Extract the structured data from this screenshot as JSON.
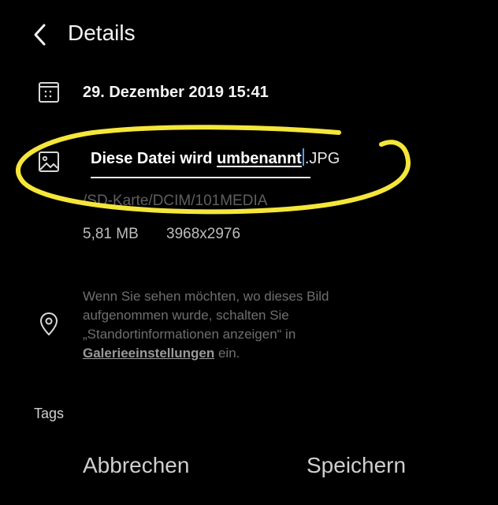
{
  "header": {
    "title": "Details",
    "back_icon": "chevron-left-icon"
  },
  "date": {
    "icon": "calendar-icon",
    "text": "29. Dezember 2019 15:41"
  },
  "file": {
    "icon": "image-icon",
    "name_prefix": "Diese Datei wird ",
    "name_underlined": "umbenannt",
    "extension": ".JPG",
    "path": "/SD-Karte/DCIM/101MEDIA",
    "size": "5,81 MB",
    "resolution": "3968x2976"
  },
  "location": {
    "icon": "location-pin-icon",
    "text_before": "Wenn Sie sehen möchten, wo dieses Bild aufgenommen wurde, schalten Sie „Standortinformationen anzeigen“ in ",
    "link": "Galerieeinstellungen",
    "text_after": " ein."
  },
  "tags_label": "Tags",
  "buttons": {
    "cancel": "Abbrechen",
    "save": "Speichern"
  },
  "colors": {
    "background": "#000000",
    "highlight_annotation": "#f5e63a",
    "cursor": "#4aa3ff"
  }
}
